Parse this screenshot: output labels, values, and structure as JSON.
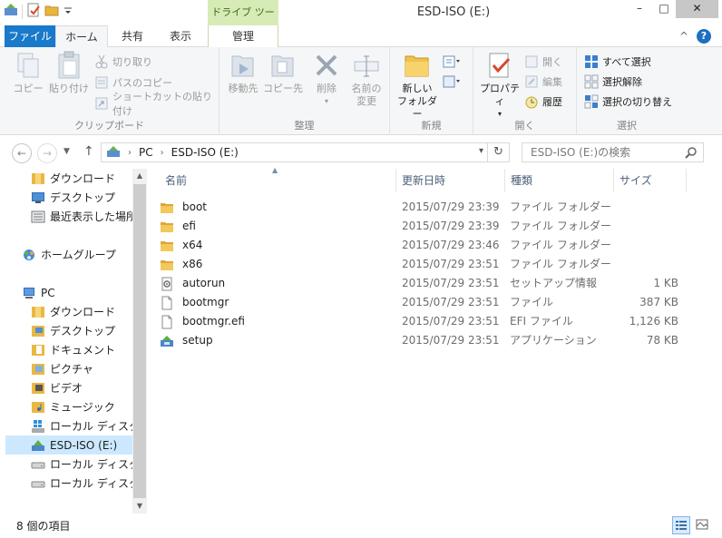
{
  "window": {
    "title": "ESD-ISO (E:)",
    "context_tab_header": "ドライブ ツール",
    "minimize": "–",
    "maximize": "□",
    "close": "✕"
  },
  "ribbon_tabs": {
    "file": "ファイル",
    "home": "ホーム",
    "share": "共有",
    "view": "表示",
    "manage": "管理"
  },
  "ribbon": {
    "collapse": "^",
    "help": "?",
    "clipboard": {
      "label": "クリップボード",
      "copy": "コピー",
      "paste": "貼り付け",
      "cut": "切り取り",
      "copy_path": "パスのコピー",
      "paste_shortcut": "ショートカットの貼り付け"
    },
    "organize": {
      "label": "整理",
      "move_to": "移動先",
      "copy_to": "コピー先",
      "delete": "削除",
      "rename_line1": "名前の",
      "rename_line2": "変更"
    },
    "new": {
      "label": "新規",
      "new_folder_line1": "新しい",
      "new_folder_line2": "フォルダー"
    },
    "open": {
      "label": "開く",
      "properties": "プロパティ",
      "open": "開く",
      "edit": "編集",
      "history": "履歴"
    },
    "select": {
      "label": "選択",
      "select_all": "すべて選択",
      "select_none": "選択解除",
      "invert": "選択の切り替え"
    }
  },
  "address": {
    "crumbs": [
      "PC",
      "ESD-ISO (E:)"
    ],
    "search_placeholder": "ESD-ISO (E:)の検索"
  },
  "nav_pane": {
    "items": [
      {
        "label": "ダウンロード",
        "icon": "downloads-folder-icon",
        "selected": false
      },
      {
        "label": "デスクトップ",
        "icon": "desktop-icon",
        "selected": false
      },
      {
        "label": "最近表示した場所",
        "icon": "recent-places-icon",
        "selected": false
      },
      {
        "label": "ホームグループ",
        "icon": "homegroup-icon",
        "selected": false
      },
      {
        "label": "PC",
        "icon": "pc-icon",
        "selected": false
      },
      {
        "label": "ダウンロード",
        "icon": "downloads-folder-icon",
        "selected": false
      },
      {
        "label": "デスクトップ",
        "icon": "desktop-folder-icon",
        "selected": false
      },
      {
        "label": "ドキュメント",
        "icon": "documents-folder-icon",
        "selected": false
      },
      {
        "label": "ピクチャ",
        "icon": "pictures-folder-icon",
        "selected": false
      },
      {
        "label": "ビデオ",
        "icon": "videos-folder-icon",
        "selected": false
      },
      {
        "label": "ミュージック",
        "icon": "music-folder-icon",
        "selected": false
      },
      {
        "label": "ローカル ディスク (C",
        "icon": "windows-drive-icon",
        "selected": false
      },
      {
        "label": "ESD-ISO (E:)",
        "icon": "dvd-drive-icon",
        "selected": true
      },
      {
        "label": "ローカル ディスク (F",
        "icon": "drive-icon",
        "selected": false
      },
      {
        "label": "ローカル ディスク (G",
        "icon": "drive-icon",
        "selected": false
      }
    ]
  },
  "columns": {
    "name": "名前",
    "date": "更新日時",
    "type": "種類",
    "size": "サイズ"
  },
  "files": [
    {
      "name": "boot",
      "date": "2015/07/29 23:39",
      "type": "ファイル フォルダー",
      "size": "",
      "icon": "folder-icon"
    },
    {
      "name": "efi",
      "date": "2015/07/29 23:39",
      "type": "ファイル フォルダー",
      "size": "",
      "icon": "folder-icon"
    },
    {
      "name": "x64",
      "date": "2015/07/29 23:46",
      "type": "ファイル フォルダー",
      "size": "",
      "icon": "folder-icon"
    },
    {
      "name": "x86",
      "date": "2015/07/29 23:51",
      "type": "ファイル フォルダー",
      "size": "",
      "icon": "folder-icon"
    },
    {
      "name": "autorun",
      "date": "2015/07/29 23:51",
      "type": "セットアップ情報",
      "size": "1 KB",
      "icon": "setup-info-icon"
    },
    {
      "name": "bootmgr",
      "date": "2015/07/29 23:51",
      "type": "ファイル",
      "size": "387 KB",
      "icon": "file-icon"
    },
    {
      "name": "bootmgr.efi",
      "date": "2015/07/29 23:51",
      "type": "EFI ファイル",
      "size": "1,126 KB",
      "icon": "file-icon"
    },
    {
      "name": "setup",
      "date": "2015/07/29 23:51",
      "type": "アプリケーション",
      "size": "78 KB",
      "icon": "setup-app-icon"
    }
  ],
  "status": {
    "item_count": "8 個の項目"
  },
  "colors": {
    "file_tab": "#1979ca",
    "selection": "#cce8ff",
    "context_tab": "#d7ebb7",
    "folder": "#e8b540"
  }
}
